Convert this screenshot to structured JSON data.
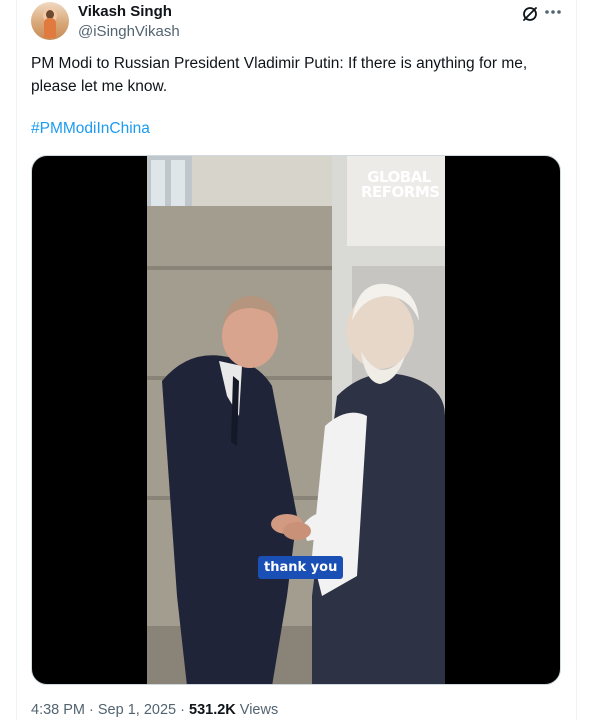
{
  "author": {
    "name": "Vikash Singh",
    "handle": "@iSinghVikash"
  },
  "tweet": {
    "text": "PM Modi to Russian President Vladimir Putin: If there is anything for me, please let me know.",
    "hashtag": "#PMModiInChina"
  },
  "media": {
    "watermark_line1": "GLOBAL",
    "watermark_line2": "REFORMS",
    "caption": "thank you"
  },
  "meta": {
    "time": "4:38 PM",
    "separator": " · ",
    "date": "Sep 1, 2025",
    "views_count": "531.2K",
    "views_label": "Views"
  },
  "icons": {
    "grok": "grok-icon",
    "more": "more-icon"
  },
  "colors": {
    "link": "#1d9bf0",
    "secondary_text": "#536471",
    "caption_bg": "#1a4fb5"
  }
}
